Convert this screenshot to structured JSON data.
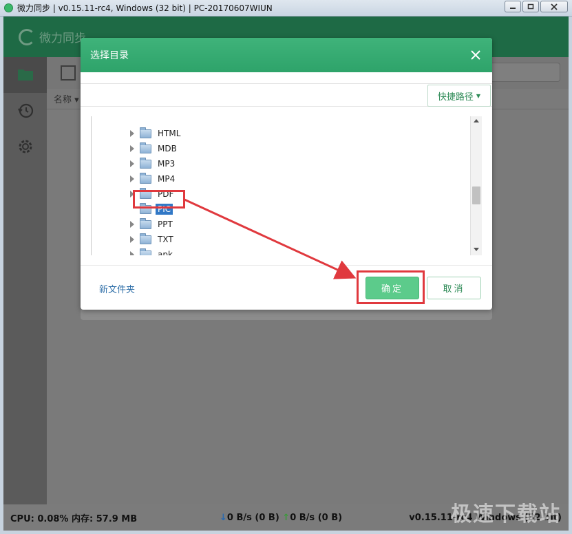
{
  "window": {
    "title": "微力同步 | v0.15.11-rc4, Windows (32 bit) | PC-20170607WIUN",
    "minimize": "▭",
    "maximize": "▢",
    "close": "✕"
  },
  "app": {
    "logo_text": "微力同步",
    "column_name": "名称 ▾"
  },
  "dialog": {
    "title": "选择目录",
    "close": "✕",
    "quick_path": "快捷路径",
    "folders": [
      {
        "label": "HTML",
        "selected": false
      },
      {
        "label": "MDB",
        "selected": false
      },
      {
        "label": "MP3",
        "selected": false
      },
      {
        "label": "MP4",
        "selected": false
      },
      {
        "label": "PDF",
        "selected": false
      },
      {
        "label": "PIC",
        "selected": true
      },
      {
        "label": "PPT",
        "selected": false
      },
      {
        "label": "TXT",
        "selected": false
      },
      {
        "label": "apk",
        "selected": false
      }
    ],
    "new_folder": "新文件夹",
    "ok": "确定",
    "cancel": "取消"
  },
  "status": {
    "cpu": "CPU: 0.08%  内存: 57.9 MB",
    "down": "↓",
    "down_text": "0 B/s (0 B) ",
    "up": "↑",
    "up_text": "0 B/s (0 B)",
    "version": "v0.15.11-rc4 Windows (32 bit)"
  },
  "watermark": "极速下载站",
  "colors": {
    "accent_green": "#2ea36a",
    "selection_blue": "#3178c6",
    "annotation_red": "#e0393e"
  }
}
